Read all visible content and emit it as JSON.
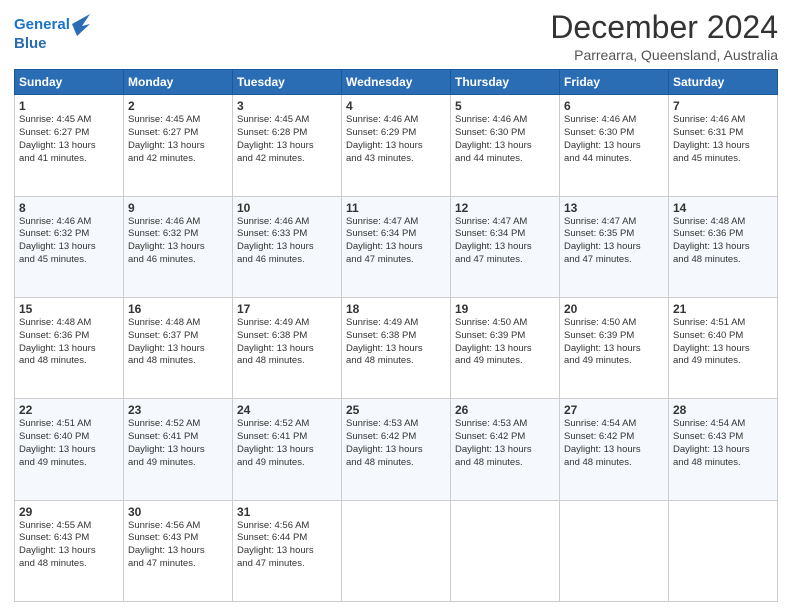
{
  "logo": {
    "line1": "General",
    "line2": "Blue"
  },
  "title": "December 2024",
  "subtitle": "Parrearra, Queensland, Australia",
  "days_header": [
    "Sunday",
    "Monday",
    "Tuesday",
    "Wednesday",
    "Thursday",
    "Friday",
    "Saturday"
  ],
  "weeks": [
    [
      {
        "day": "1",
        "info": "Sunrise: 4:45 AM\nSunset: 6:27 PM\nDaylight: 13 hours\nand 41 minutes."
      },
      {
        "day": "2",
        "info": "Sunrise: 4:45 AM\nSunset: 6:27 PM\nDaylight: 13 hours\nand 42 minutes."
      },
      {
        "day": "3",
        "info": "Sunrise: 4:45 AM\nSunset: 6:28 PM\nDaylight: 13 hours\nand 42 minutes."
      },
      {
        "day": "4",
        "info": "Sunrise: 4:46 AM\nSunset: 6:29 PM\nDaylight: 13 hours\nand 43 minutes."
      },
      {
        "day": "5",
        "info": "Sunrise: 4:46 AM\nSunset: 6:30 PM\nDaylight: 13 hours\nand 44 minutes."
      },
      {
        "day": "6",
        "info": "Sunrise: 4:46 AM\nSunset: 6:30 PM\nDaylight: 13 hours\nand 44 minutes."
      },
      {
        "day": "7",
        "info": "Sunrise: 4:46 AM\nSunset: 6:31 PM\nDaylight: 13 hours\nand 45 minutes."
      }
    ],
    [
      {
        "day": "8",
        "info": "Sunrise: 4:46 AM\nSunset: 6:32 PM\nDaylight: 13 hours\nand 45 minutes."
      },
      {
        "day": "9",
        "info": "Sunrise: 4:46 AM\nSunset: 6:32 PM\nDaylight: 13 hours\nand 46 minutes."
      },
      {
        "day": "10",
        "info": "Sunrise: 4:46 AM\nSunset: 6:33 PM\nDaylight: 13 hours\nand 46 minutes."
      },
      {
        "day": "11",
        "info": "Sunrise: 4:47 AM\nSunset: 6:34 PM\nDaylight: 13 hours\nand 47 minutes."
      },
      {
        "day": "12",
        "info": "Sunrise: 4:47 AM\nSunset: 6:34 PM\nDaylight: 13 hours\nand 47 minutes."
      },
      {
        "day": "13",
        "info": "Sunrise: 4:47 AM\nSunset: 6:35 PM\nDaylight: 13 hours\nand 47 minutes."
      },
      {
        "day": "14",
        "info": "Sunrise: 4:48 AM\nSunset: 6:36 PM\nDaylight: 13 hours\nand 48 minutes."
      }
    ],
    [
      {
        "day": "15",
        "info": "Sunrise: 4:48 AM\nSunset: 6:36 PM\nDaylight: 13 hours\nand 48 minutes."
      },
      {
        "day": "16",
        "info": "Sunrise: 4:48 AM\nSunset: 6:37 PM\nDaylight: 13 hours\nand 48 minutes."
      },
      {
        "day": "17",
        "info": "Sunrise: 4:49 AM\nSunset: 6:38 PM\nDaylight: 13 hours\nand 48 minutes."
      },
      {
        "day": "18",
        "info": "Sunrise: 4:49 AM\nSunset: 6:38 PM\nDaylight: 13 hours\nand 48 minutes."
      },
      {
        "day": "19",
        "info": "Sunrise: 4:50 AM\nSunset: 6:39 PM\nDaylight: 13 hours\nand 49 minutes."
      },
      {
        "day": "20",
        "info": "Sunrise: 4:50 AM\nSunset: 6:39 PM\nDaylight: 13 hours\nand 49 minutes."
      },
      {
        "day": "21",
        "info": "Sunrise: 4:51 AM\nSunset: 6:40 PM\nDaylight: 13 hours\nand 49 minutes."
      }
    ],
    [
      {
        "day": "22",
        "info": "Sunrise: 4:51 AM\nSunset: 6:40 PM\nDaylight: 13 hours\nand 49 minutes."
      },
      {
        "day": "23",
        "info": "Sunrise: 4:52 AM\nSunset: 6:41 PM\nDaylight: 13 hours\nand 49 minutes."
      },
      {
        "day": "24",
        "info": "Sunrise: 4:52 AM\nSunset: 6:41 PM\nDaylight: 13 hours\nand 49 minutes."
      },
      {
        "day": "25",
        "info": "Sunrise: 4:53 AM\nSunset: 6:42 PM\nDaylight: 13 hours\nand 48 minutes."
      },
      {
        "day": "26",
        "info": "Sunrise: 4:53 AM\nSunset: 6:42 PM\nDaylight: 13 hours\nand 48 minutes."
      },
      {
        "day": "27",
        "info": "Sunrise: 4:54 AM\nSunset: 6:42 PM\nDaylight: 13 hours\nand 48 minutes."
      },
      {
        "day": "28",
        "info": "Sunrise: 4:54 AM\nSunset: 6:43 PM\nDaylight: 13 hours\nand 48 minutes."
      }
    ],
    [
      {
        "day": "29",
        "info": "Sunrise: 4:55 AM\nSunset: 6:43 PM\nDaylight: 13 hours\nand 48 minutes."
      },
      {
        "day": "30",
        "info": "Sunrise: 4:56 AM\nSunset: 6:43 PM\nDaylight: 13 hours\nand 47 minutes."
      },
      {
        "day": "31",
        "info": "Sunrise: 4:56 AM\nSunset: 6:44 PM\nDaylight: 13 hours\nand 47 minutes."
      },
      {
        "day": "",
        "info": ""
      },
      {
        "day": "",
        "info": ""
      },
      {
        "day": "",
        "info": ""
      },
      {
        "day": "",
        "info": ""
      }
    ]
  ]
}
